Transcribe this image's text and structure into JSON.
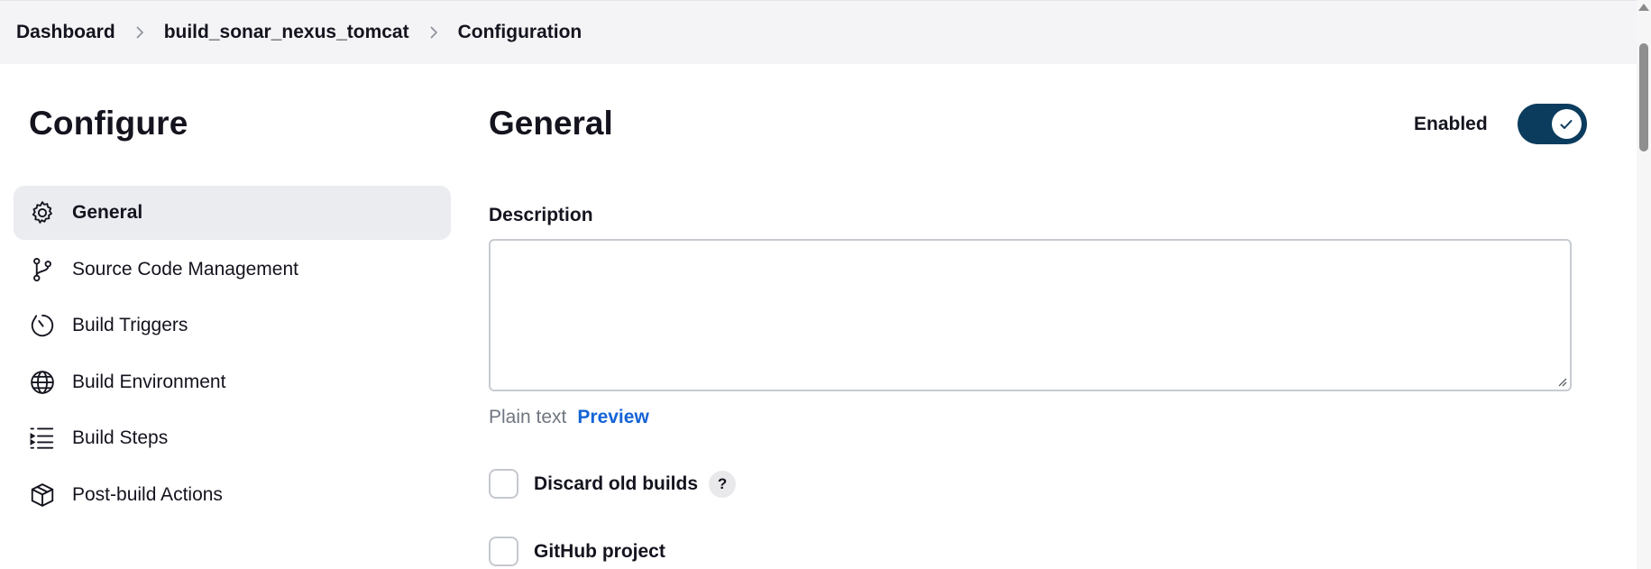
{
  "breadcrumb": {
    "items": [
      "Dashboard",
      "build_sonar_nexus_tomcat",
      "Configuration"
    ]
  },
  "sidebar": {
    "title": "Configure",
    "items": [
      {
        "label": "General",
        "icon": "gear-icon",
        "active": true
      },
      {
        "label": "Source Code Management",
        "icon": "git-branch-icon",
        "active": false
      },
      {
        "label": "Build Triggers",
        "icon": "clock-icon",
        "active": false
      },
      {
        "label": "Build Environment",
        "icon": "globe-icon",
        "active": false
      },
      {
        "label": "Build Steps",
        "icon": "list-steps-icon",
        "active": false
      },
      {
        "label": "Post-build Actions",
        "icon": "package-icon",
        "active": false
      }
    ]
  },
  "main": {
    "title": "General",
    "enabled_label": "Enabled",
    "enabled": true,
    "description_label": "Description",
    "description_value": "",
    "format_plain": "Plain text",
    "format_preview": "Preview",
    "options": [
      {
        "label": "Discard old builds",
        "checked": false,
        "help": "?"
      },
      {
        "label": "GitHub project",
        "checked": false
      }
    ]
  },
  "colors": {
    "accent": "#0b3c5d",
    "link": "#1463d6",
    "active_nav_bg": "#ebecf0",
    "breadcrumb_bg": "#f4f4f6"
  }
}
